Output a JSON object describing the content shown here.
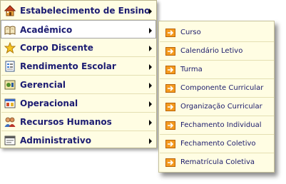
{
  "main_menu": {
    "items": [
      {
        "label": "Estabelecimento de Ensino",
        "icon": "school-house-icon"
      },
      {
        "label": "Acadêmico",
        "icon": "open-book-icon",
        "active": true
      },
      {
        "label": "Corpo Discente",
        "icon": "star-icon"
      },
      {
        "label": "Rendimento Escolar",
        "icon": "report-card-icon"
      },
      {
        "label": "Gerencial",
        "icon": "management-icon"
      },
      {
        "label": "Operacional",
        "icon": "operations-icon"
      },
      {
        "label": "Recursos Humanos",
        "icon": "people-icon"
      },
      {
        "label": "Administrativo",
        "icon": "admin-window-icon"
      }
    ]
  },
  "sub_menu": {
    "parent": "Acadêmico",
    "items": [
      {
        "label": "Curso"
      },
      {
        "label": "Calendário Letivo"
      },
      {
        "label": "Turma"
      },
      {
        "label": "Componente Curricular"
      },
      {
        "label": "Organização Curricular"
      },
      {
        "label": "Fechamento Individual"
      },
      {
        "label": "Fechamento Coletivo"
      },
      {
        "label": "Rematrícula Coletiva"
      }
    ],
    "item_icon": "orange-arrow-icon"
  },
  "colors": {
    "menu_background": "#fffde3",
    "label_text": "#1c1c72",
    "arrow_icon": "#f59a1e"
  }
}
